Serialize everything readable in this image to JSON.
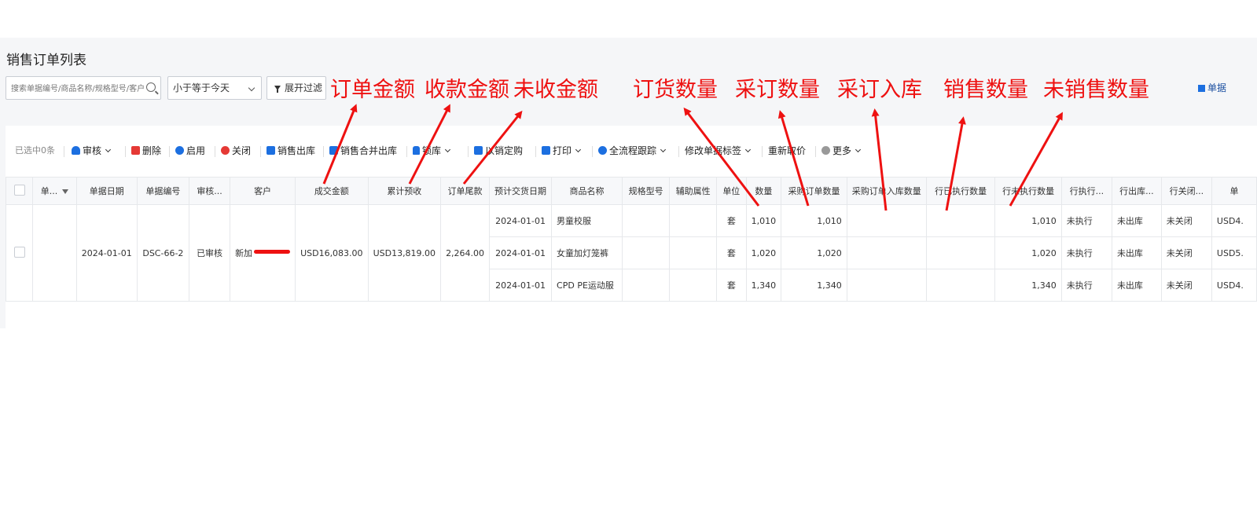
{
  "page": {
    "title": "销售订单列表"
  },
  "filters": {
    "search_placeholder": "搜索单据编号/商品名称/规格型号/客户",
    "date_select": "小于等于今天",
    "expand_filter_label": "展开过滤",
    "right_link": "单据"
  },
  "annotations": [
    "订单金额",
    "收款金额",
    "未收金额",
    "订货数量",
    "采订数量",
    "采订入库",
    "销售数量",
    "未销售数量"
  ],
  "toolbar": {
    "selected_count": "已选中0条",
    "approve": "审核",
    "delete": "删除",
    "enable": "启用",
    "close": "关闭",
    "sales_outbound": "销售出库",
    "merge_outbound": "销售合并出库",
    "lock_stock": "锁库",
    "purchase_by_sales": "以销定购",
    "print": "打印",
    "process_tracking": "全流程跟踪",
    "modify_tags": "修改单据标签",
    "reprice": "重新取价",
    "more": "更多",
    "colors": {
      "approve": "#1c6fe0",
      "delete": "#e53935",
      "enable": "#1c6fe0",
      "close": "#e53935",
      "outbound": "#1c6fe0"
    }
  },
  "table": {
    "headers": [
      "单...",
      "单据日期",
      "单据编号",
      "审核...",
      "客户",
      "成交金额",
      "累计预收",
      "订单尾款",
      "预计交货日期",
      "商品名称",
      "规格型号",
      "辅助属性",
      "单位",
      "数量",
      "采购订单数量",
      "采购订单入库数量",
      "行已执行数量",
      "行未执行数量",
      "行执行...",
      "行出库...",
      "行关闭...",
      "单"
    ],
    "order": {
      "date": "2024-01-01",
      "number": "DSC-66-2",
      "status": "已审核",
      "customer": "新加",
      "amount": "USD16,083.00",
      "prepaid": "USD13,819.00",
      "balance": "2,264.00"
    },
    "rows": [
      {
        "delivery_date": "2024-01-01",
        "product": "男童校服",
        "unit": "套",
        "qty": "1,010",
        "po_qty": "1,010",
        "po_in_qty": "",
        "done_qty": "",
        "undone_qty": "1,010",
        "exec": "未执行",
        "outbound": "未出库",
        "closed": "未关闭",
        "price": "USD4."
      },
      {
        "delivery_date": "2024-01-01",
        "product": "女童加灯笼裤",
        "unit": "套",
        "qty": "1,020",
        "po_qty": "1,020",
        "po_in_qty": "",
        "done_qty": "",
        "undone_qty": "1,020",
        "exec": "未执行",
        "outbound": "未出库",
        "closed": "未关闭",
        "price": "USD5."
      },
      {
        "delivery_date": "2024-01-01",
        "product": "CPD PE运动服",
        "unit": "套",
        "qty": "1,340",
        "po_qty": "1,340",
        "po_in_qty": "",
        "done_qty": "",
        "undone_qty": "1,340",
        "exec": "未执行",
        "outbound": "未出库",
        "closed": "未关闭",
        "price": "USD4."
      }
    ]
  }
}
